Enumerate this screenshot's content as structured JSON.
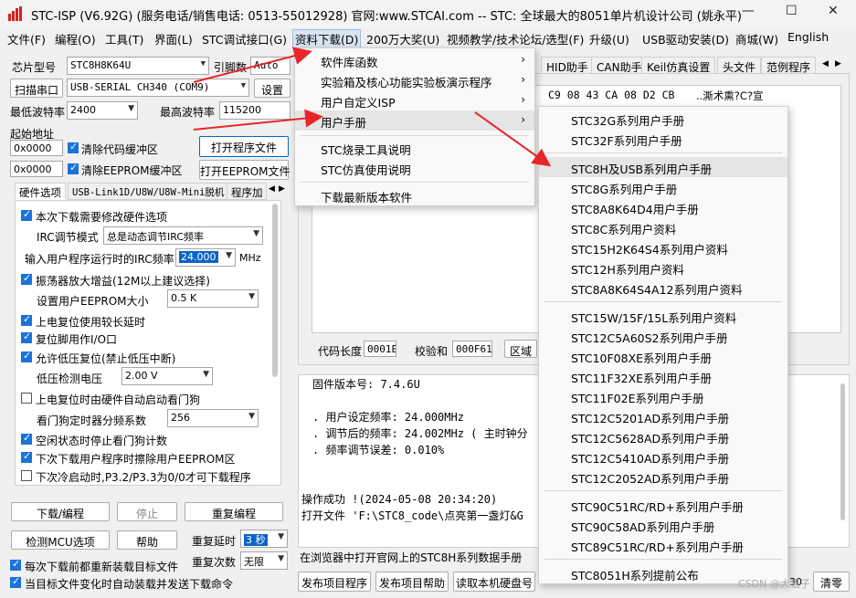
{
  "window": {
    "title": "STC-ISP (V6.92G) (服务电话/销售电话: 0513-55012928) 官网:www.STCAI.com  -- STC: 全球最大的8051单片机设计公司 (姚永平)"
  },
  "menubar": [
    "文件(F)",
    "编程(O)",
    "工具(T)",
    "界面(L)",
    "STC调试接口(G)",
    "资料下载(D)",
    "200万大奖(U)",
    "视频教学/技术论坛/选型(F)",
    "升级(U)",
    "USB驱动安装(D)",
    "商城(W)",
    "English"
  ],
  "left": {
    "chip_label": "芯片型号",
    "chip_value": "STC8H8K64U",
    "pin_label": "引脚数",
    "pin_value": "Auto",
    "scan_button": "扫描串口",
    "port_value": "USB-SERIAL CH340 (COM9)",
    "settings_button": "设置",
    "min_baud_label": "最低波特率",
    "min_baud_value": "2400",
    "max_baud_label": "最高波特率",
    "max_baud_value": "115200",
    "start_addr_label": "起始地址",
    "addr1": "0x0000",
    "clear_code": "清除代码缓冲区",
    "open_prog": "打开程序文件",
    "addr2": "0x0000",
    "clear_eeprom": "清除EEPROM缓冲区",
    "open_eeprom": "打开EEPROM文件",
    "tabs": [
      "硬件选项",
      "USB-Link1D/U8W/U8W-Mini脱机",
      "程序加"
    ],
    "hw": {
      "modify_hw": "本次下载需要修改硬件选项",
      "irc_mode_label": "IRC调节模式",
      "irc_mode_value": "总是动态调节IRC频率",
      "irc_freq_label": "输入用户程序运行时的IRC频率",
      "irc_freq_value": "24.000",
      "irc_unit": "MHz",
      "osc_gain": "振荡器放大增益(12M以上建议选择)",
      "eeprom_size_label": "设置用户EEPROM大小",
      "eeprom_size_value": "0.5 K",
      "power_delay": "上电复位使用较长延时",
      "reset_pin": "复位脚用作I/O口",
      "low_volt_reset": "允许低压复位(禁止低压中断)",
      "low_volt_label": "低压检测电压",
      "low_volt_value": "2.00 V",
      "wdt_start": "上电复位时由硬件自动启动看门狗",
      "wdt_div_label": "看门狗定时器分频系数",
      "wdt_div_value": "256",
      "idle_wdt": "空闲状态时停止看门狗计数",
      "erase_eeprom": "下次下载用户程序时擦除用户EEPROM区",
      "p32_cold": "下次冷启动时,P3.2/P3.3为0/0才可下载程序"
    },
    "download_btn": "下载/编程",
    "stop_btn": "停止",
    "reprog_btn": "重复编程",
    "detect_btn": "检测MCU选项",
    "help_btn": "帮助",
    "repeat_delay_label": "重复延时",
    "repeat_delay_value": "3 秒",
    "repeat_count_label": "重复次数",
    "repeat_count_value": "无限",
    "reload_each": "每次下载前都重新装载目标文件",
    "auto_send": "当目标文件变化时自动装载并发送下载命令"
  },
  "right": {
    "tabs": [
      "HID助手",
      "CAN助手",
      "Keil仿真设置",
      "头文件",
      "范例程序"
    ],
    "hex_line": "C9 08 43 CA 08 D2 CB",
    "ascii_line": "..澌术熏?C?宣",
    "code_len_label": "代码长度",
    "code_len_value": "0001E",
    "checksum_label": "校验和",
    "checksum_value": "000F61",
    "region_label": "区域",
    "log_lines": [
      "固件版本号: 7.4.6U",
      "",
      ". 用户设定频率: 24.000MHz",
      ". 调节后的频率: 24.002MHz ( 主时钟分",
      ". 频率调节误差: 0.010%",
      "",
      "",
      "操作成功 !(2024-05-08 20:34:20)",
      "打开文件 'F:\\STC8_code\\点亮第一盏灯&G"
    ],
    "status": "在浏览器中打开官网上的STC8H系列数据手册",
    "bottom_buttons": [
      "发布项目程序",
      "发布项目帮助",
      "读取本机硬盘号"
    ],
    "bottom_right": "清零",
    "bottom_num": "30"
  },
  "download_menu": {
    "items": [
      {
        "label": "软件库函数",
        "sub": "›"
      },
      {
        "label": "实验箱及核心功能实验板演示程序",
        "sub": "›"
      },
      {
        "label": "用户自定义ISP",
        "sub": "›"
      },
      {
        "label": "用户手册",
        "sub": "›"
      },
      {
        "label": "STC烧录工具说明",
        "sub": ""
      },
      {
        "label": "STC仿真使用说明",
        "sub": ""
      },
      {
        "label": "下载最新版本软件",
        "sub": ""
      }
    ]
  },
  "manual_menu": {
    "items": [
      "STC32G系列用户手册",
      "STC32F系列用户手册",
      "STC8H及USB系列用户手册",
      "STC8G系列用户手册",
      "STC8A8K64D4用户手册",
      "STC8C系列用户资料",
      "STC15H2K64S4系列用户资料",
      "STC12H系列用户资料",
      "STC8A8K64S4A12系列用户资料",
      "STC15W/15F/15L系列用户资料",
      "STC12C5A60S2系列用户手册",
      "STC10F08XE系列用户手册",
      "STC11F32XE系列用户手册",
      "STC11F02E系列用户手册",
      "STC12C5201AD系列用户手册",
      "STC12C5628AD系列用户手册",
      "STC12C5410AD系列用户手册",
      "STC12C2052AD系列用户手册",
      "STC90C51RC/RD+系列用户手册",
      "STC90C58AD系列用户手册",
      "STC89C51RC/RD+系列用户手册",
      "STC8051H系列提前公布"
    ]
  },
  "watermark": "CSDN @大猫子",
  "colors": {
    "accent": "#1a73d9",
    "arrow": "#e8262a",
    "highlight": "#e5e5e5"
  }
}
